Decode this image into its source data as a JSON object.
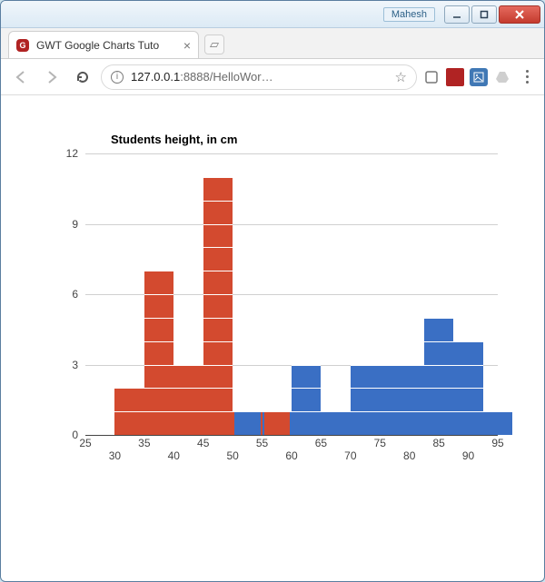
{
  "window": {
    "profile_label": "Mahesh",
    "minimize_tip": "Minimize",
    "maximize_tip": "Maximize",
    "close_tip": "Close"
  },
  "tab": {
    "title": "GWT Google Charts Tuto",
    "favicon_letter": "G"
  },
  "toolbar": {
    "back_tip": "Back",
    "forward_tip": "Forward",
    "reload_tip": "Reload",
    "url_host": "127.0.0.1",
    "url_port": ":8888",
    "url_path": "/HelloWor…",
    "star_tip": "Bookmark",
    "menu_tip": "Menu"
  },
  "chart_data": {
    "type": "bar",
    "title": "Students height, in cm",
    "xlabel": "",
    "ylabel": "",
    "ylim": [
      0,
      12
    ],
    "y_ticks": [
      0,
      3,
      6,
      9,
      12
    ],
    "xlim": [
      25,
      95
    ],
    "x_ticks_major": [
      25,
      35,
      45,
      55,
      65,
      75,
      85,
      95
    ],
    "x_ticks_minor": [
      30,
      40,
      50,
      60,
      70,
      80,
      90
    ],
    "bin_width": 5,
    "colors": {
      "red": "#d34a2f",
      "blue": "#3a6fc4"
    },
    "bars": [
      {
        "x_start": 30,
        "value": 2,
        "color": "red"
      },
      {
        "x_start": 35,
        "value": 7,
        "color": "red"
      },
      {
        "x_start": 40,
        "value": 3,
        "color": "red"
      },
      {
        "x_start": 45,
        "value": 11,
        "color": "red"
      },
      {
        "x_start": 50,
        "value": 1,
        "color": "red"
      },
      {
        "x_start": 55,
        "value": 1,
        "color": "blue"
      },
      {
        "x_start": 60,
        "value": 3,
        "color": "blue"
      },
      {
        "x_start": 65,
        "value": 1,
        "color": "blue"
      },
      {
        "x_start": 70,
        "value": 3,
        "color": "blue"
      },
      {
        "x_start": 75,
        "value": 3,
        "color": "blue"
      },
      {
        "x_start": 80,
        "value": 3,
        "color": "blue"
      },
      {
        "x_start": 82.5,
        "value": 5,
        "color": "blue"
      },
      {
        "x_start": 87.5,
        "value": 4,
        "color": "blue"
      },
      {
        "x_start": 92.5,
        "value": 1,
        "color": "blue"
      }
    ],
    "overlays": [
      {
        "x_start": 50,
        "value": 1,
        "color": "blue",
        "inset": 2
      },
      {
        "x_start": 55,
        "value": 1,
        "color": "red",
        "inset": 2
      }
    ]
  }
}
